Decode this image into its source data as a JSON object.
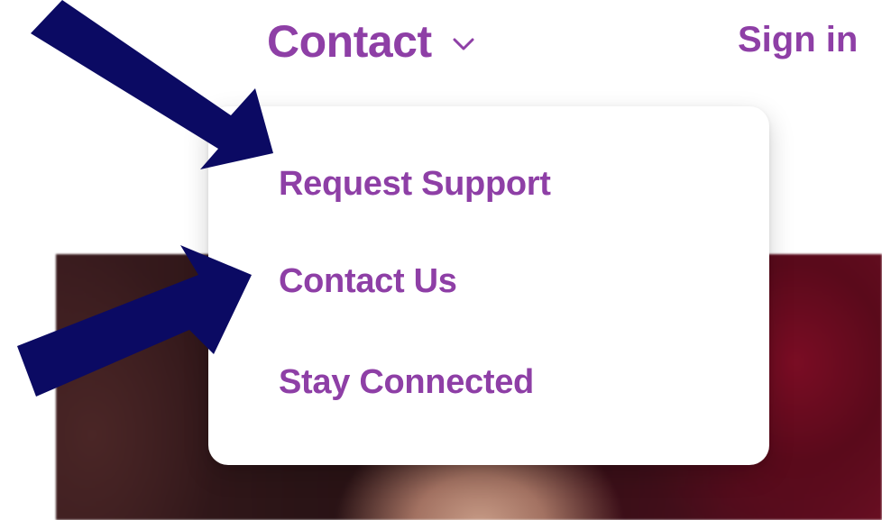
{
  "nav": {
    "contact_label": "Contact",
    "signin_label": "Sign in"
  },
  "dropdown": {
    "items": [
      {
        "label": "Request Support"
      },
      {
        "label": "Contact Us"
      },
      {
        "label": "Stay Connected"
      }
    ]
  },
  "colors": {
    "accent": "#8e3fa6",
    "arrow": "#0b0a63"
  },
  "icons": {
    "dropdown_toggle": "chevron-down-icon",
    "annotation": "arrow-icon"
  }
}
